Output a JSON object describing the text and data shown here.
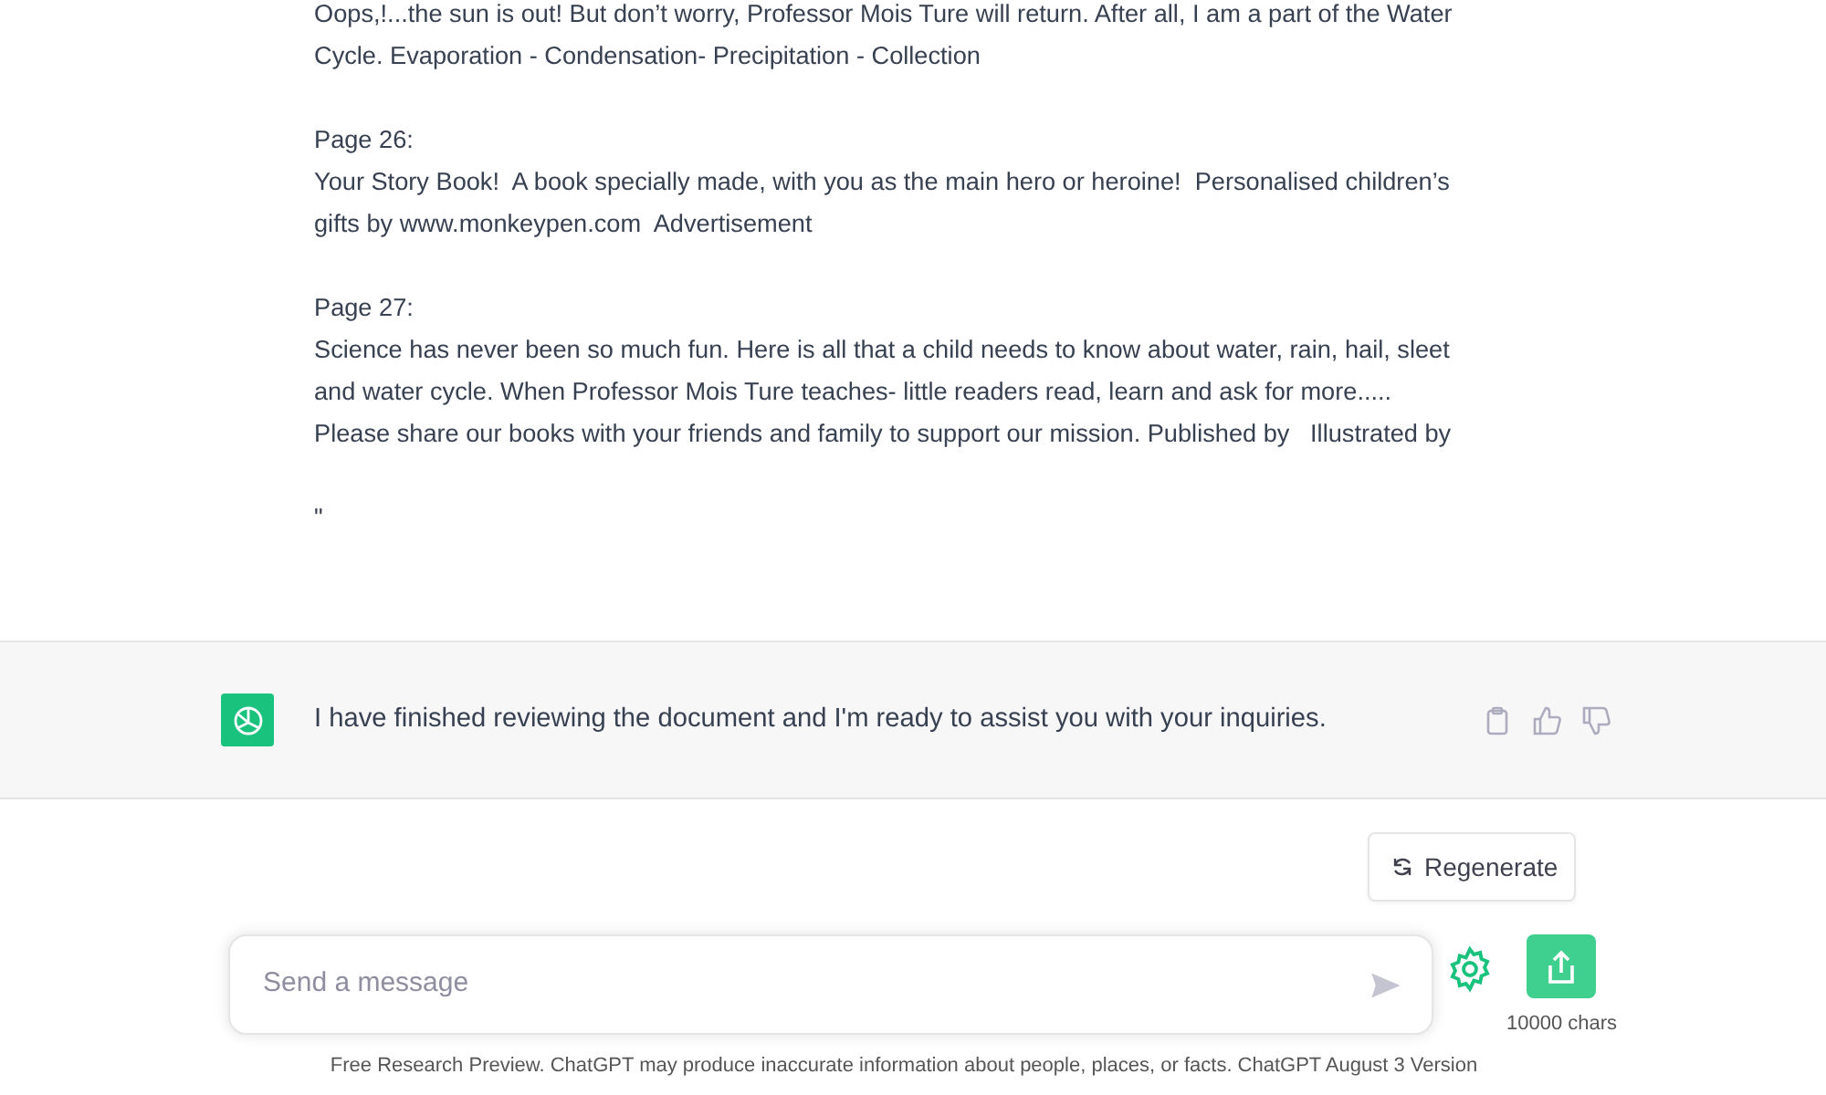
{
  "document_message": {
    "blocks": [
      {
        "lines": [
          "Oops,!...the sun is out! But don’t worry, Professor Mois Ture will return. After all, I am a part of the Water Cycle. Evaporation - Condensation- Precipitation - Collection"
        ]
      },
      {
        "lines": [
          "Page 26:",
          "Your Story Book!  A book specially made, with you as the main hero or heroine!  Personalised children’s gifts by www.monkeypen.com  Advertisement"
        ]
      },
      {
        "lines": [
          "Page 27:",
          "Science has never been so much fun. Here is all that a child needs to know about water, rain, hail, sleet and water cycle. When Professor Mois Ture teaches- little readers read, learn and ask for more.....  Please share our books with your friends and family to support our mission. Published by   Illustrated by"
        ]
      },
      {
        "lines": [
          "\""
        ]
      }
    ]
  },
  "assistant_message": {
    "text": "I have finished reviewing the document and I'm ready to assist you with your inquiries."
  },
  "regenerate_button": {
    "label": "Regenerate"
  },
  "composer": {
    "placeholder": "Send a message",
    "char_count": "10000 chars"
  },
  "footer": "Free Research Preview. ChatGPT may produce inaccurate information about people, places, or facts. ChatGPT August 3 Version"
}
